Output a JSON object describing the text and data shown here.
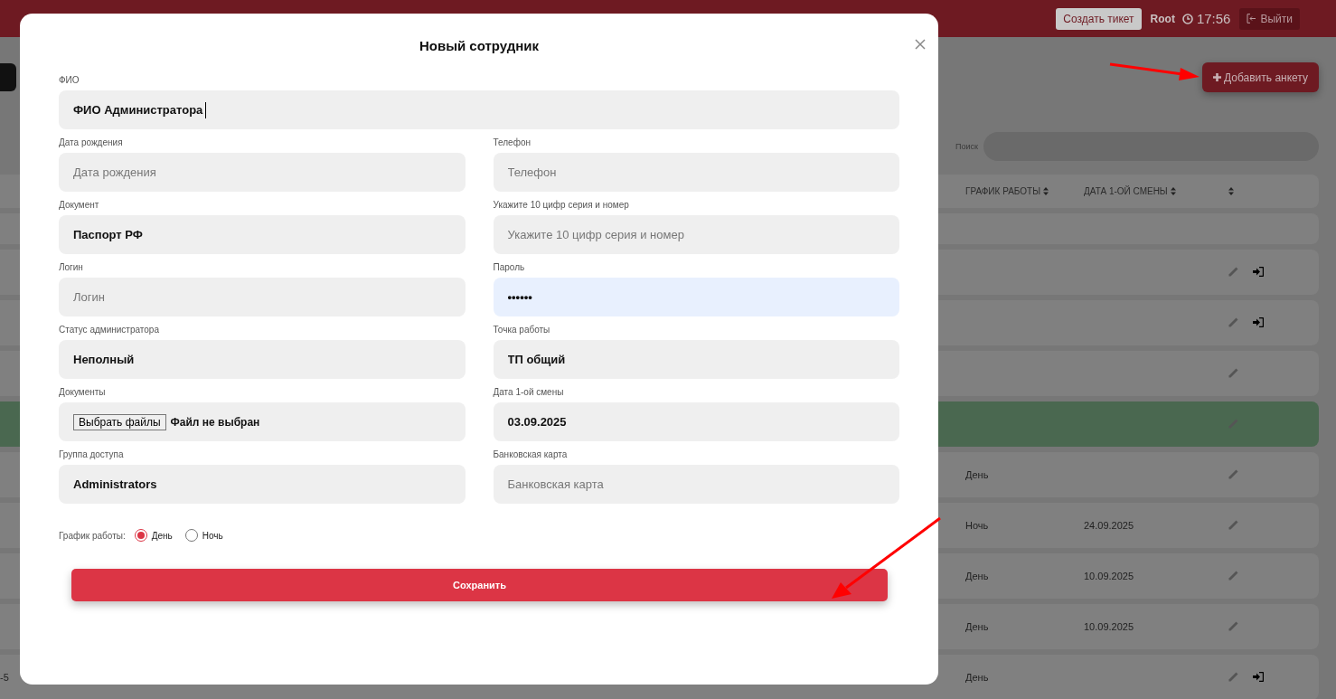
{
  "header": {
    "ticket_button": "Создать тикет",
    "user": "Root",
    "time": "17:56",
    "logout_button": "Выйти"
  },
  "add_button": "Добавить анкету",
  "search": {
    "label": "Поиск"
  },
  "table": {
    "columns": [
      "ГРАФИК РАБОТЫ",
      "ДАТА 1-ОЙ СМЕНЫ"
    ],
    "rows": [
      {
        "editable": false,
        "login": false,
        "highlighted": false
      },
      {
        "editable": true,
        "login": true,
        "highlighted": false
      },
      {
        "editable": true,
        "login": true,
        "highlighted": false
      },
      {
        "editable": true,
        "login": false,
        "highlighted": false
      },
      {
        "editable": true,
        "login": false,
        "highlighted": true
      },
      {
        "schedule": "День",
        "editable": true,
        "login": false,
        "highlighted": false
      },
      {
        "schedule": "Ночь",
        "first_shift": "24.09.2025",
        "editable": true,
        "login": false,
        "highlighted": false
      },
      {
        "schedule": "День",
        "first_shift": "10.09.2025",
        "editable": true,
        "login": false,
        "highlighted": false
      },
      {
        "schedule": "День",
        "first_shift": "10.09.2025",
        "editable": true,
        "login": false,
        "highlighted": false
      },
      {
        "column_1": "-5",
        "schedule": "День",
        "editable": true,
        "login": true,
        "highlighted": false
      }
    ]
  },
  "modal": {
    "title": "Новый сотрудник",
    "fields": [
      {
        "kind": "text",
        "label": "ФИО",
        "value": "ФИО Администратора",
        "wide": true,
        "focused": true
      },
      {
        "kind": "text",
        "label": "Дата рождения",
        "placeholder": "Дата рождения"
      },
      {
        "kind": "text",
        "label": "Телефон",
        "placeholder": "Телефон"
      },
      {
        "kind": "text",
        "label": "Документ",
        "value": "Паспорт РФ"
      },
      {
        "kind": "text",
        "label": "Укажите 10 цифр серия и номер",
        "placeholder": "Укажите 10 цифр серия и номер"
      },
      {
        "kind": "text",
        "label": "Логин",
        "placeholder": "Логин"
      },
      {
        "kind": "password",
        "label": "Пароль",
        "value": "••••••",
        "autofilled": true
      },
      {
        "kind": "text",
        "label": "Статус администратора",
        "value": "Неполный"
      },
      {
        "kind": "text",
        "label": "Точка работы",
        "value": "ТП общий"
      },
      {
        "kind": "file",
        "label": "Документы",
        "button": "Выбрать файлы",
        "status": "Файл не выбран"
      },
      {
        "kind": "text",
        "label": "Дата 1-ой смены",
        "value": "03.09.2025"
      },
      {
        "kind": "text",
        "label": "Группа доступа",
        "value": "Administrators"
      },
      {
        "kind": "text",
        "label": "Банковская карта",
        "placeholder": "Банковская карта"
      }
    ],
    "schedule": {
      "label": "График работы:",
      "options": [
        {
          "label": "День",
          "selected": true
        },
        {
          "label": "Ночь",
          "selected": false
        }
      ]
    },
    "save_button": "Сохранить"
  }
}
